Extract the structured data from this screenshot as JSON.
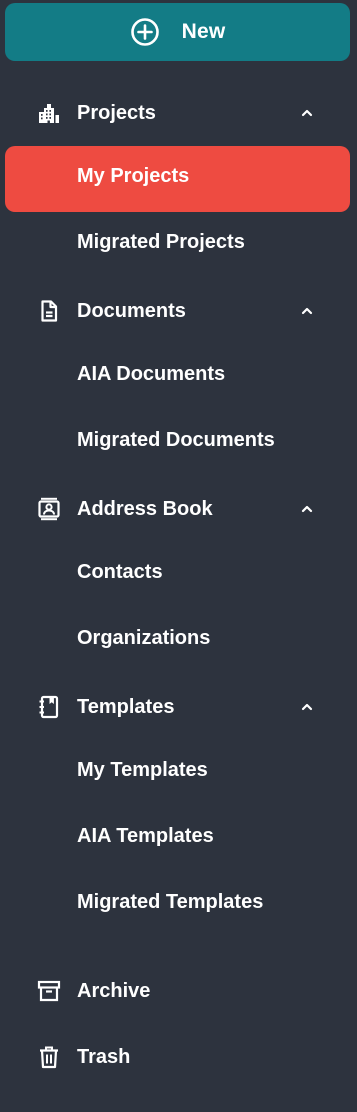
{
  "new_button": {
    "label": "New",
    "icon": "plus-circle-icon",
    "color": "#137c86"
  },
  "sections": [
    {
      "label": "Projects",
      "icon": "building-icon",
      "expanded": true,
      "items": [
        "My Projects",
        "Migrated Projects"
      ]
    },
    {
      "label": "Documents",
      "icon": "document-icon",
      "expanded": true,
      "items": [
        "AIA Documents",
        "Migrated Documents"
      ]
    },
    {
      "label": "Address Book",
      "icon": "contact-card-icon",
      "expanded": true,
      "items": [
        "Contacts",
        "Organizations"
      ]
    },
    {
      "label": "Templates",
      "icon": "notebook-icon",
      "expanded": true,
      "items": [
        "My Templates",
        "AIA Templates",
        "Migrated Templates"
      ]
    }
  ],
  "active_item": "My Projects",
  "bottom_items": [
    {
      "label": "Archive",
      "icon": "archive-box-icon"
    },
    {
      "label": "Trash",
      "icon": "trash-icon"
    }
  ],
  "colors": {
    "sidebar_background": "#2d333e",
    "active_item_background": "#ee4b41",
    "text": "#ffffff"
  }
}
